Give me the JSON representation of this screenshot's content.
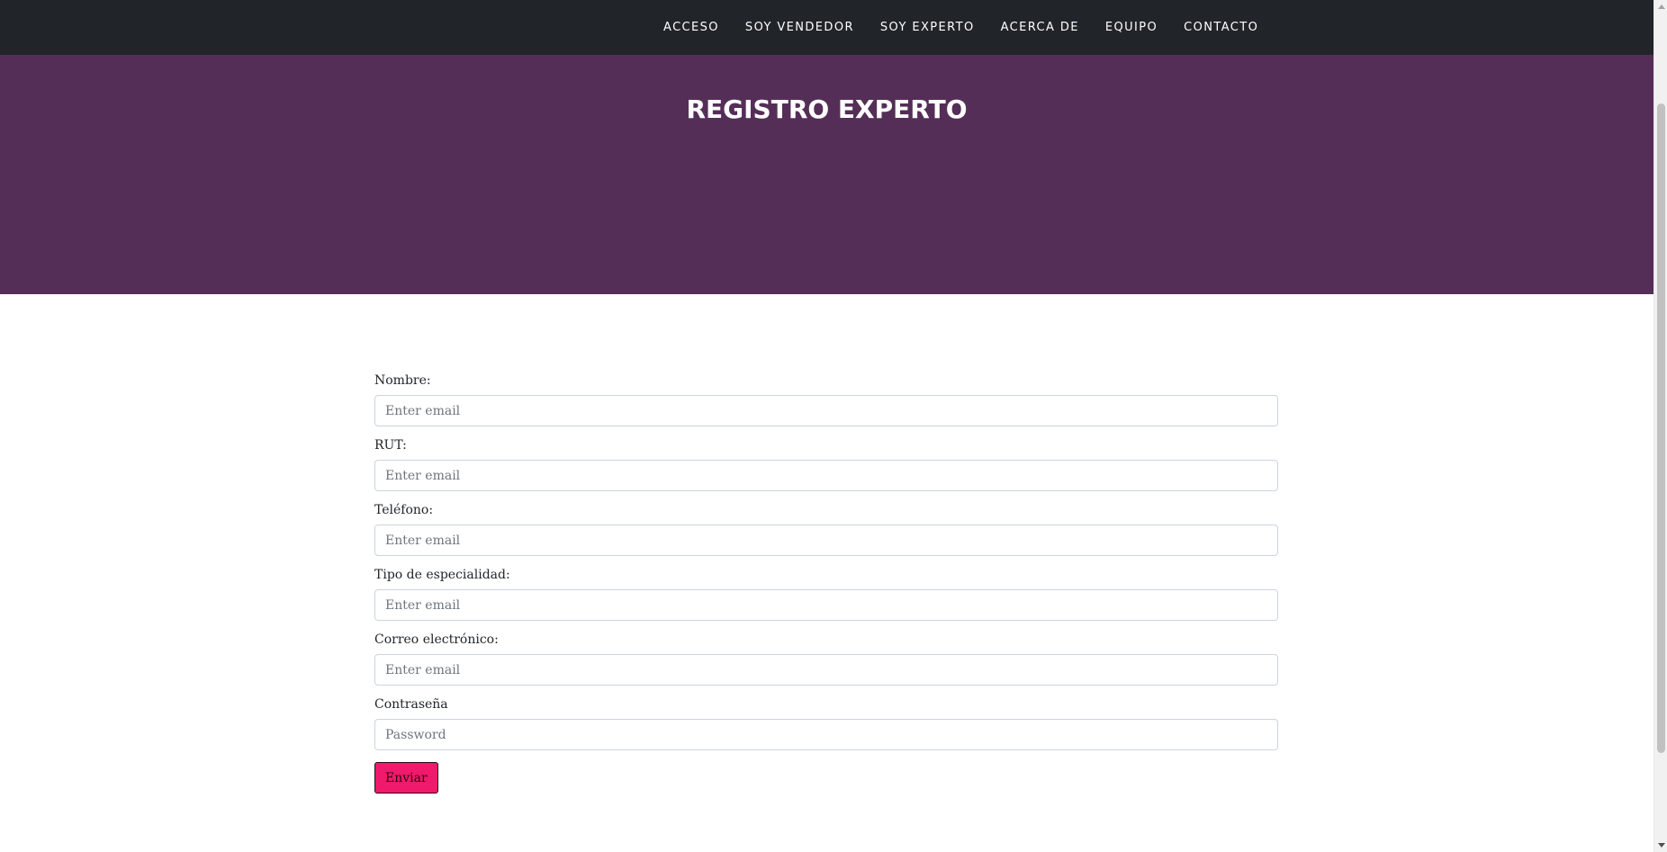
{
  "nav": {
    "items": [
      {
        "label": "ACCESO"
      },
      {
        "label": "SOY VENDEDOR"
      },
      {
        "label": "SOY EXPERTO"
      },
      {
        "label": "ACERCA DE"
      },
      {
        "label": "EQUIPO"
      },
      {
        "label": "CONTACTO"
      }
    ]
  },
  "header": {
    "title": "REGISTRO EXPERTO"
  },
  "form": {
    "fields": [
      {
        "label": "Nombre:",
        "placeholder": "Enter email",
        "value": ""
      },
      {
        "label": "RUT:",
        "placeholder": "Enter email",
        "value": ""
      },
      {
        "label": "Teléfono:",
        "placeholder": "Enter email",
        "value": ""
      },
      {
        "label": "Tipo de especialidad:",
        "placeholder": "Enter email",
        "value": ""
      },
      {
        "label": "Correo electrónico:",
        "placeholder": "Enter email",
        "value": ""
      },
      {
        "label": "Contraseña",
        "placeholder": "Password",
        "value": ""
      }
    ],
    "submit_label": "Enviar"
  },
  "colors": {
    "navbar": "#212529",
    "masthead": "#552e58",
    "button": "#f0196b"
  }
}
